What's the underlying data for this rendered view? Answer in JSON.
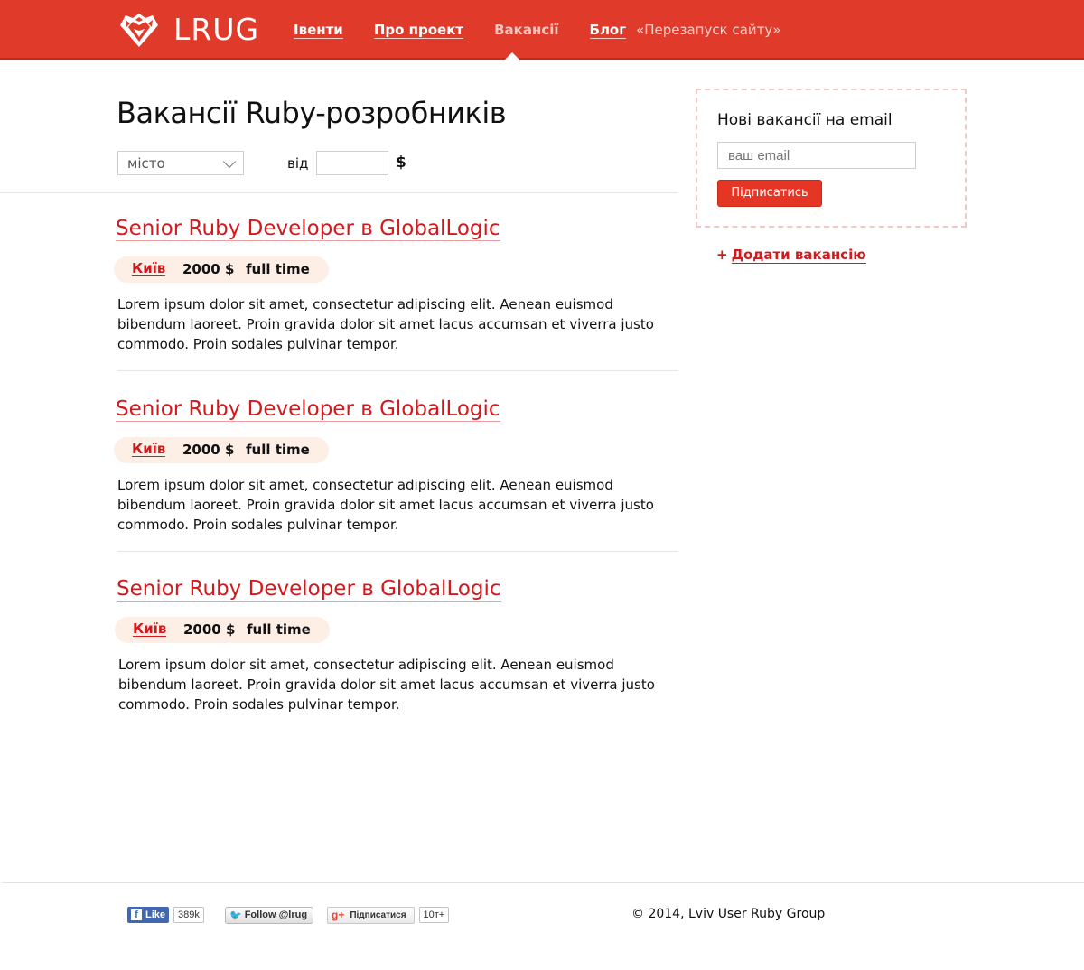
{
  "header": {
    "logo_text": "LRUG",
    "nav": [
      {
        "label": "Івенти"
      },
      {
        "label": "Про проект"
      },
      {
        "label": "Вакансії"
      },
      {
        "label": "Блог"
      }
    ],
    "blog_note": "«Перезапуск сайту»"
  },
  "main": {
    "title": "Вакансії Ruby-розробників",
    "filters": {
      "city_selected": "місто",
      "from_label": "від",
      "salary_value": "",
      "currency": "$"
    }
  },
  "jobs": [
    {
      "title": "Senior Ruby Developer в GlobalLogic",
      "city": "Київ",
      "salary": "2000 $",
      "type": "full time",
      "description": "Lorem ipsum dolor sit amet, consectetur adipiscing elit. Aenean euismod bibendum laoreet. Proin gravida dolor sit amet lacus accumsan et viverra justo commodo. Proin sodales pulvinar tempor."
    },
    {
      "title": "Senior Ruby Developer в GlobalLogic",
      "city": "Київ",
      "salary": "2000 $",
      "type": "full time",
      "description": "Lorem ipsum dolor sit amet, consectetur adipiscing elit. Aenean euismod bibendum laoreet. Proin gravida dolor sit amet lacus accumsan et viverra justo commodo. Proin sodales pulvinar tempor."
    },
    {
      "title": "Senior Ruby Developer в GlobalLogic",
      "city": "Київ",
      "salary": "2000 $",
      "type": "full time",
      "description": "Lorem ipsum dolor sit amet, consectetur adipiscing elit. Aenean euismod bibendum laoreet. Proin gravida dolor sit amet lacus accumsan et viverra justo commodo. Proin sodales pulvinar tempor."
    }
  ],
  "sidebar": {
    "subscribe_title": "Нові вакансії на email",
    "email_placeholder": "ваш email",
    "subscribe_button": "Підписатись",
    "add_job_plus": "+",
    "add_job_label": "Додати вакансію"
  },
  "footer": {
    "facebook": {
      "icon": "facebook-icon",
      "label": "Like",
      "count": "389k"
    },
    "twitter": {
      "icon": "twitter-bird-icon",
      "label": "Follow @lrug"
    },
    "gplus": {
      "icon": "google-plus-icon",
      "label": "Підписатися",
      "count": "10т+"
    },
    "copyright": "© 2014, Lviv User Ruby Group"
  },
  "colors": {
    "brand_red": "#e03a2b",
    "link_red": "#d4181c",
    "meta_bg": "#fdeee6"
  }
}
